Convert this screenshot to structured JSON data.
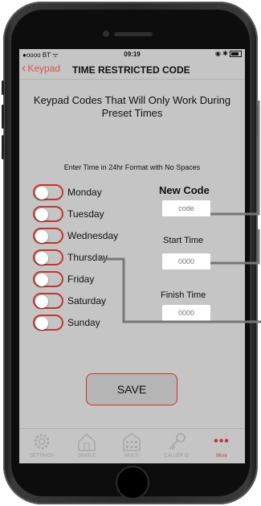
{
  "status_bar": {
    "carrier": "●oooo BT",
    "wifi": "wifi-icon",
    "time": "09:19",
    "icons": "◉ ✱"
  },
  "nav": {
    "back_label": "Keypad",
    "title": "TIME RESTRICTED CODE"
  },
  "heading": "Keypad Codes That Will Only Work During Preset Times",
  "hint": "Enter Time in 24hr Format with No Spaces",
  "days": [
    {
      "label": "Monday",
      "on": false
    },
    {
      "label": "Tuesday",
      "on": false
    },
    {
      "label": "Wednesday",
      "on": false
    },
    {
      "label": "Thursday",
      "on": false
    },
    {
      "label": "Friday",
      "on": false
    },
    {
      "label": "Saturday",
      "on": false
    },
    {
      "label": "Sunday",
      "on": false
    }
  ],
  "new_code": {
    "label": "New Code",
    "placeholder": "code"
  },
  "start_time": {
    "label": "Start Time",
    "placeholder": "0000"
  },
  "finish_time": {
    "label": "Finish Time",
    "placeholder": "0000"
  },
  "save_label": "SAVE",
  "tabs": [
    {
      "label": "SETTINGS",
      "icon": "gear-icon"
    },
    {
      "label": "SINGLE",
      "icon": "house-icon"
    },
    {
      "label": "MULTI",
      "icon": "building-icon"
    },
    {
      "label": "CALLER ID",
      "icon": "key-icon"
    },
    {
      "label": "More",
      "icon": "more-icon"
    }
  ],
  "colors": {
    "accent": "#c0392b",
    "screen_bg": "#c5c5c5",
    "connector": "#777777"
  }
}
